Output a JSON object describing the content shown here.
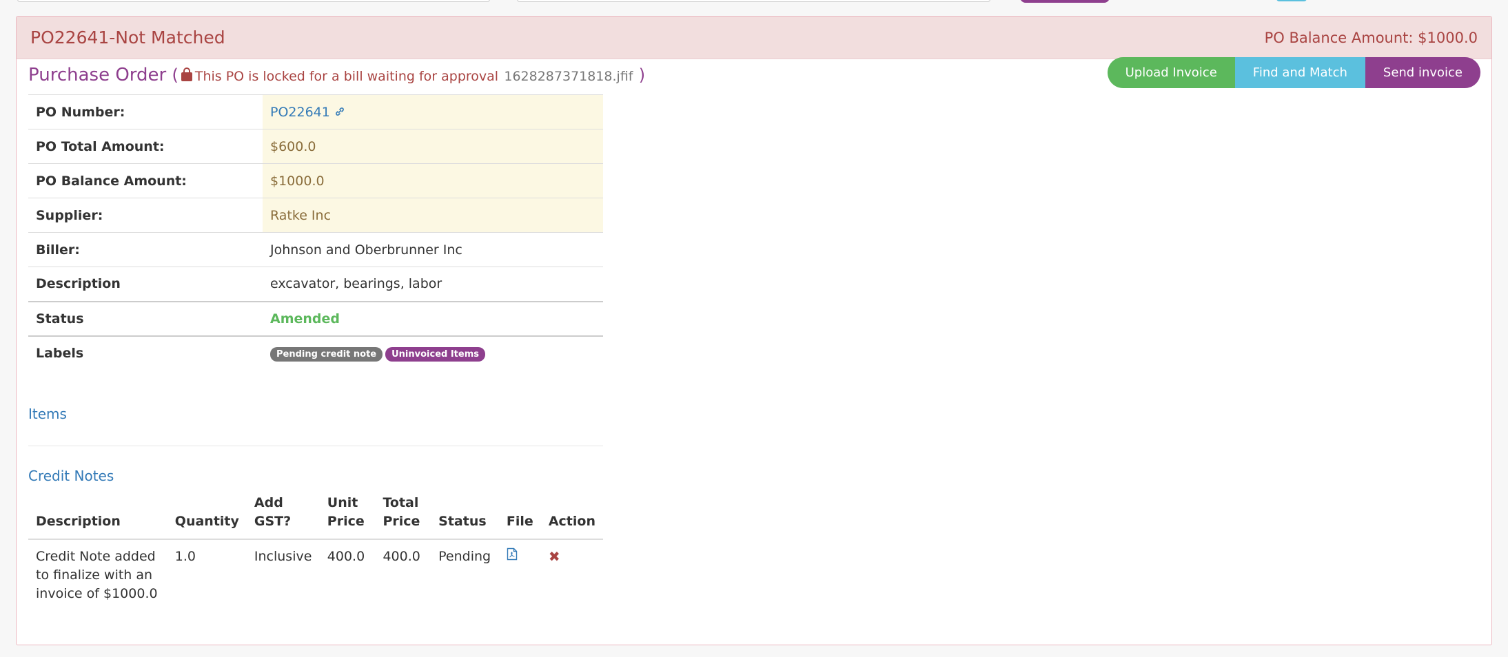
{
  "panel": {
    "title": "PO22641-Not Matched",
    "balance": "PO Balance Amount: $1000.0"
  },
  "po": {
    "heading": "Purchase Order",
    "paren_open": "(",
    "lock_message": "This PO is locked for a bill waiting for approval",
    "locked_file": "1628287371818.jfif",
    "paren_close": ")"
  },
  "actions": {
    "upload": "Upload Invoice",
    "find": "Find and Match",
    "send": "Send invoice"
  },
  "details": {
    "po_number_label": "PO Number:",
    "po_number": "PO22641",
    "total_label": "PO Total Amount:",
    "total": "$600.0",
    "balance_label": "PO Balance Amount:",
    "balance": "$1000.0",
    "supplier_label": "Supplier:",
    "supplier": "Ratke Inc",
    "biller_label": "Biller:",
    "biller": "Johnson and Oberbrunner Inc",
    "description_label": "Description",
    "description": "excavator, bearings, labor",
    "status_label": "Status",
    "status": "Amended",
    "labels_label": "Labels",
    "labels": [
      "Pending credit note",
      "Uninvoiced Items"
    ]
  },
  "sections": {
    "items": "Items",
    "credit_notes": "Credit Notes"
  },
  "credit_notes": {
    "headers": {
      "description": "Description",
      "quantity": "Quantity",
      "gst": "Add GST?",
      "unit_price": "Unit Price",
      "total_price": "Total Price",
      "status": "Status",
      "file": "File",
      "action": "Action"
    },
    "rows": [
      {
        "description": "Credit Note added to finalize with an invoice of $1000.0",
        "quantity": "1.0",
        "gst": "Inclusive",
        "unit_price": "400.0",
        "total_price": "400.0",
        "status": "Pending"
      }
    ]
  },
  "colors": {
    "danger": "#a94442",
    "success": "#5cb85c",
    "info": "#5bc0de",
    "purple": "#8e3f8e",
    "link": "#337ab7"
  }
}
